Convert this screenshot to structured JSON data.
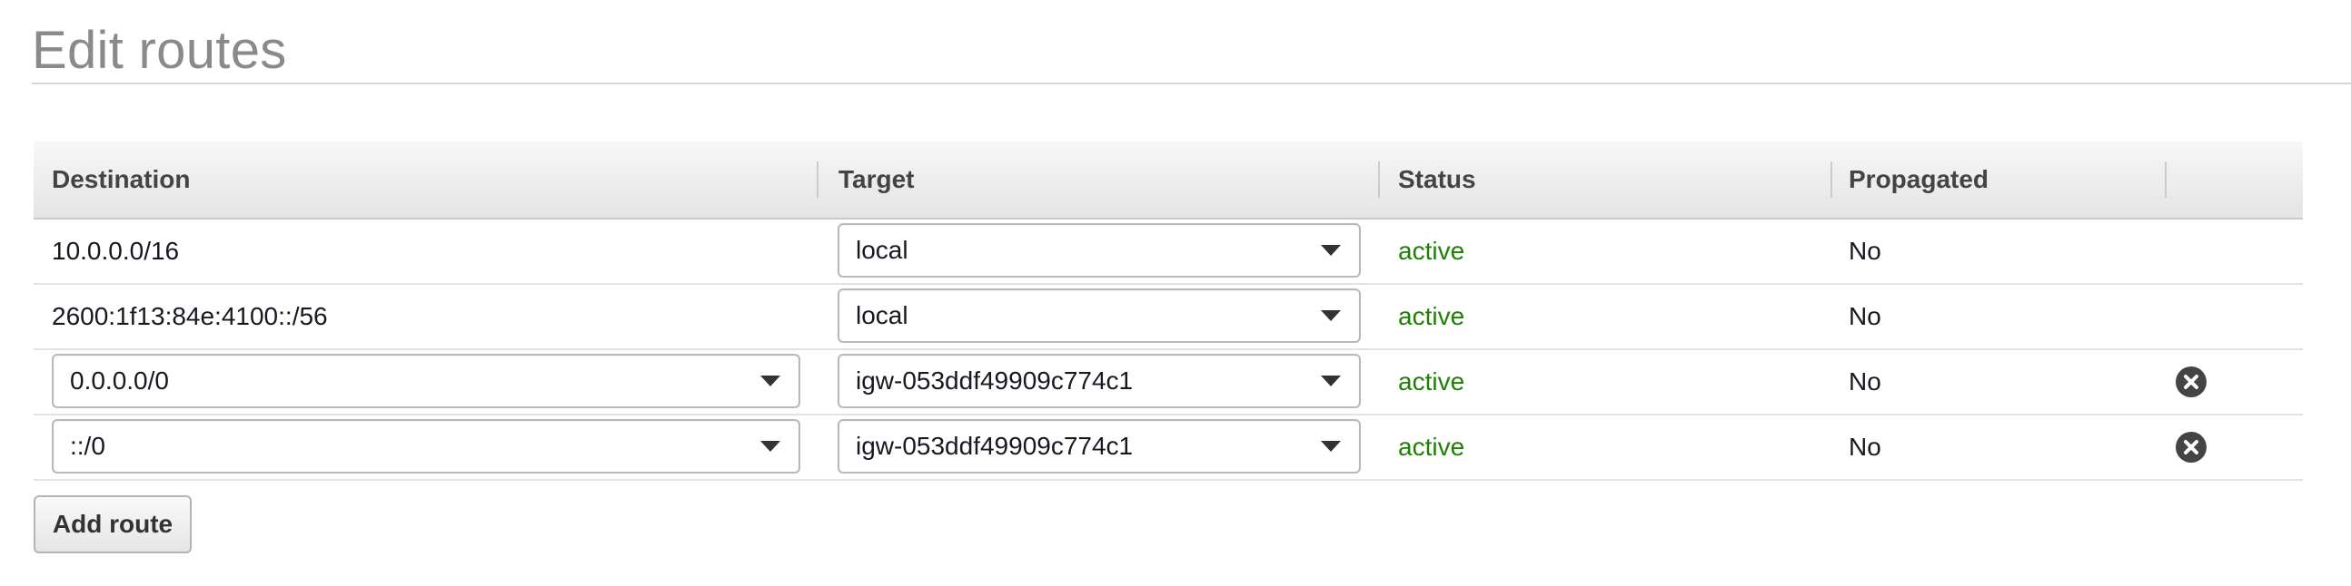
{
  "page": {
    "title": "Edit routes"
  },
  "table": {
    "headers": {
      "destination": "Destination",
      "target": "Target",
      "status": "Status",
      "propagated": "Propagated"
    },
    "rows": [
      {
        "destination": "10.0.0.0/16",
        "destination_editable": false,
        "target": "local",
        "status": "active",
        "propagated": "No",
        "removable": false
      },
      {
        "destination": "2600:1f13:84e:4100::/56",
        "destination_editable": false,
        "target": "local",
        "status": "active",
        "propagated": "No",
        "removable": false
      },
      {
        "destination": "0.0.0.0/0",
        "destination_editable": true,
        "target": "igw-053ddf49909c774c1",
        "status": "active",
        "propagated": "No",
        "removable": true
      },
      {
        "destination": "::/0",
        "destination_editable": true,
        "target": "igw-053ddf49909c774c1",
        "status": "active",
        "propagated": "No",
        "removable": true
      }
    ]
  },
  "actions": {
    "add_route_label": "Add route"
  },
  "colors": {
    "status_active": "#1d8102",
    "title": "#8a8a8a"
  },
  "icons": {
    "remove": "close-circle-icon",
    "dropdown": "caret-down-icon"
  }
}
